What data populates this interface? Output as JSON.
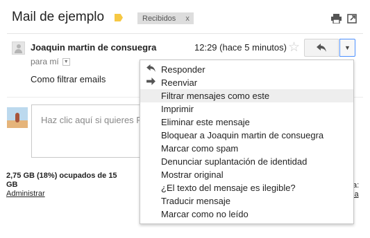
{
  "header": {
    "subject": "Mail de ejemplo",
    "label_chip": "Recibidos",
    "chip_remove": "x",
    "print_icon": "printer-icon",
    "new_window_icon": "new-window-icon",
    "label_color": "#f6c843"
  },
  "message": {
    "sender": "Joaquin martin de consuegra",
    "time": "12:29 (hace 5 minutos)",
    "to": "para mí",
    "body": "Como filtrar emails",
    "star_icon": "star-outline-icon"
  },
  "reply": {
    "placeholder": "Haz clic aquí si quieres R"
  },
  "storage": {
    "usage": "2,75 GB (18%) ocupados de 15 GB",
    "manage_link": "Administrar"
  },
  "right_fragment": {
    "line1": "a:",
    "line2": "la"
  },
  "menu": {
    "items": [
      {
        "label": "Responder",
        "icon": "reply-icon"
      },
      {
        "label": "Reenviar",
        "icon": "forward-icon"
      },
      {
        "label": "Filtrar mensajes como este"
      },
      {
        "label": "Imprimir"
      },
      {
        "label": "Eliminar este mensaje"
      },
      {
        "label": "Bloquear a Joaquin martin de consuegra"
      },
      {
        "label": "Marcar como spam"
      },
      {
        "label": "Denunciar suplantación de identidad"
      },
      {
        "label": "Mostrar original"
      },
      {
        "label": "¿El texto del mensaje es ilegible?"
      },
      {
        "label": "Traducir mensaje"
      },
      {
        "label": "Marcar como no leído"
      }
    ],
    "highlighted_index": 2
  }
}
